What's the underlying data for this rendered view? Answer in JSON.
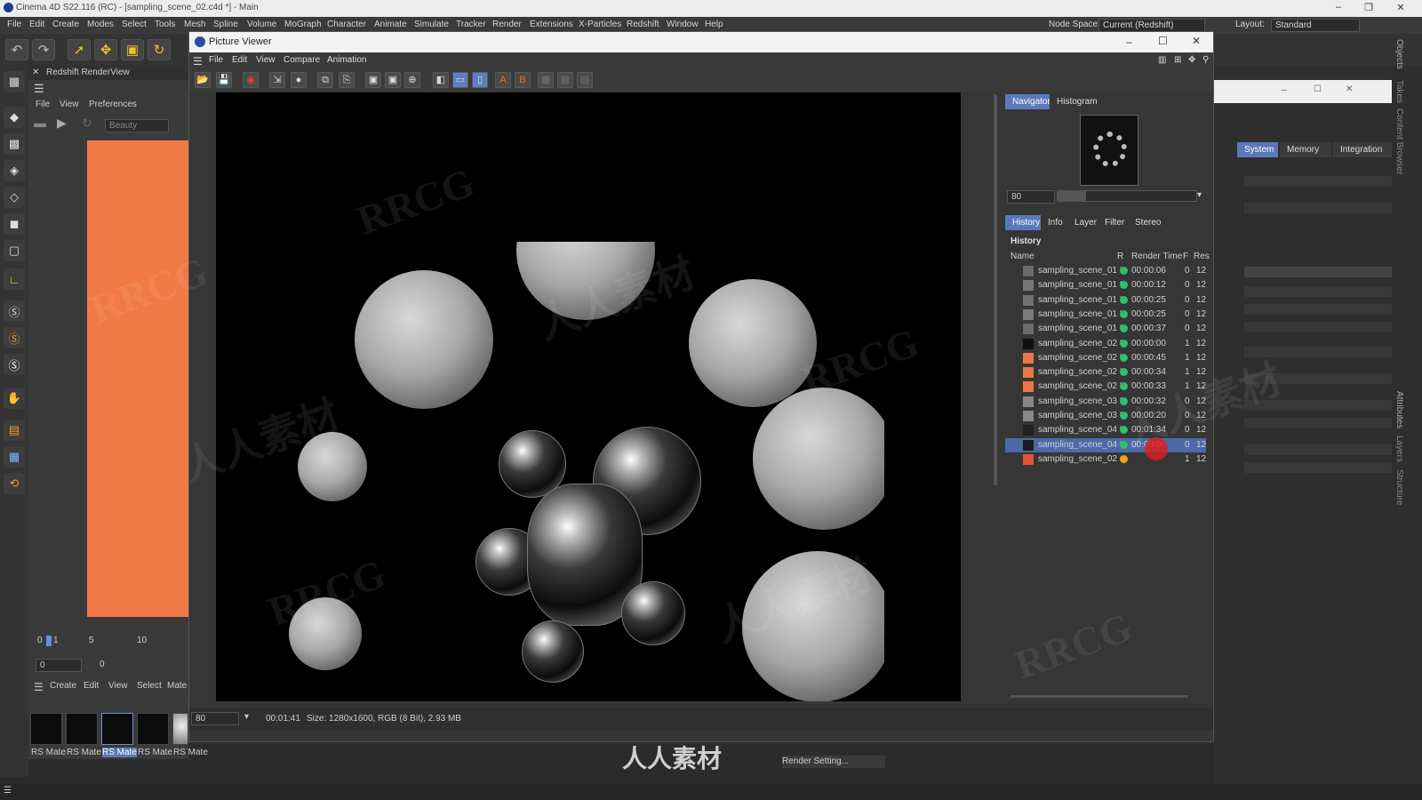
{
  "app": {
    "title": "Cinema 4D S22.116 (RC) - [sampling_scene_02.c4d *] - Main",
    "menus": [
      "File",
      "Edit",
      "Create",
      "Modes",
      "Select",
      "Tools",
      "Mesh",
      "Spline",
      "Volume",
      "MoGraph",
      "Character",
      "Animate",
      "Simulate",
      "Tracker",
      "Render",
      "Extensions",
      "X-Particles",
      "Redshift",
      "Window",
      "Help"
    ],
    "node_space_label": "Node Space:",
    "node_space_value": "Current (Redshift)",
    "layout_label": "Layout:",
    "layout_value": "Standard"
  },
  "render_view": {
    "title": "Redshift RenderView",
    "menus": [
      "File",
      "View",
      "Preferences"
    ],
    "aov": "Beauty",
    "timeline_ticks": [
      "0",
      "1",
      "5",
      "10"
    ],
    "frame_value": "0",
    "frame_value2": "0",
    "material_menus": [
      "Create",
      "Edit",
      "View",
      "Select",
      "Mate"
    ],
    "materials": [
      "RS Mate",
      "RS Mate",
      "RS Mate",
      "RS Mate",
      "RS Mate"
    ]
  },
  "right_dock": {
    "tabs": [
      "System",
      "Memory",
      "Integration"
    ],
    "side_labels": [
      "Objects",
      "Takes",
      "Content Browser",
      "Attributes",
      "Layers",
      "Structure"
    ]
  },
  "picture_viewer": {
    "title": "Picture Viewer",
    "menus": [
      "File",
      "Edit",
      "View",
      "Compare",
      "Animation"
    ],
    "nav_tabs": [
      "Navigator",
      "Histogram"
    ],
    "zoom": "80",
    "history_tabs": [
      "History",
      "Info",
      "Layer",
      "Filter",
      "Stereo"
    ],
    "history_title": "History",
    "columns": {
      "name": "Name",
      "r": "R",
      "render_time": "Render Time",
      "f": "F",
      "res": "Res"
    },
    "rows": [
      {
        "name": "sampling_scene_01 *",
        "time": "00:00:06",
        "f": "0",
        "res": "12",
        "status": "#2ec06a",
        "thumb": "#6a6a6a"
      },
      {
        "name": "sampling_scene_01 *",
        "time": "00:00:12",
        "f": "0",
        "res": "12",
        "status": "#2ec06a",
        "thumb": "#777777"
      },
      {
        "name": "sampling_scene_01 *",
        "time": "00:00:25",
        "f": "0",
        "res": "12",
        "status": "#2ec06a",
        "thumb": "#707070"
      },
      {
        "name": "sampling_scene_01 *",
        "time": "00:00:25",
        "f": "0",
        "res": "12",
        "status": "#2ec06a",
        "thumb": "#7a7a7a"
      },
      {
        "name": "sampling_scene_01 *",
        "time": "00:00:37",
        "f": "0",
        "res": "12",
        "status": "#2ec06a",
        "thumb": "#6c6c6c"
      },
      {
        "name": "sampling_scene_02 *",
        "time": "00:00:00",
        "f": "1",
        "res": "12",
        "status": "#2ec06a",
        "thumb": "#111111"
      },
      {
        "name": "sampling_scene_02 *",
        "time": "00:00:45",
        "f": "1",
        "res": "12",
        "status": "#2ec06a",
        "thumb": "#e7774a"
      },
      {
        "name": "sampling_scene_02 *",
        "time": "00:00:34",
        "f": "1",
        "res": "12",
        "status": "#2ec06a",
        "thumb": "#e7774a"
      },
      {
        "name": "sampling_scene_02 *",
        "time": "00:00:33",
        "f": "1",
        "res": "12",
        "status": "#2ec06a",
        "thumb": "#e7774a"
      },
      {
        "name": "sampling_scene_03 *",
        "time": "00:00:32",
        "f": "0",
        "res": "12",
        "status": "#2ec06a",
        "thumb": "#888888"
      },
      {
        "name": "sampling_scene_03 *",
        "time": "00:00:20",
        "f": "0",
        "res": "12",
        "status": "#2ec06a",
        "thumb": "#8a8a8a"
      },
      {
        "name": "sampling_scene_04 *",
        "time": "00:01:34",
        "f": "0",
        "res": "12",
        "status": "#2ec06a",
        "thumb": "#222222"
      },
      {
        "name": "sampling_scene_04 *",
        "time": "00:00:00",
        "f": "0",
        "res": "12",
        "status": "#2ec06a",
        "thumb": "#1c1c1c",
        "selected": true
      },
      {
        "name": "sampling_scene_02",
        "time": "",
        "f": "1",
        "res": "12",
        "status": "#f0a020",
        "thumb": "#e0533a"
      }
    ],
    "status": {
      "zoom": "80",
      "time": "00:01:41",
      "size": "Size: 1280x1600, RGB (8 Bit), 2.93 MB"
    }
  },
  "bottom": {
    "render_setting": "Render Setting..."
  },
  "watermark": {
    "logo": "人人素材",
    "text_a": "RRCG",
    "text_b": "人人素材"
  }
}
